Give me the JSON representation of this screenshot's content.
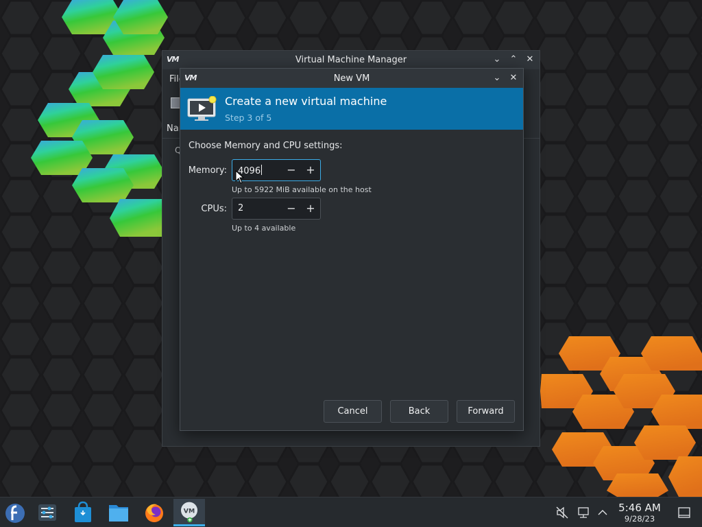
{
  "manager_window": {
    "logo": "VM",
    "title": "Virtual Machine Manager",
    "menu_partial": "File",
    "column_header_partial": "Nam",
    "row_partial": "Q"
  },
  "dialog": {
    "logo": "VM",
    "title": "New VM",
    "banner": {
      "title": "Create a new virtual machine",
      "subtitle": "Step 3 of 5"
    },
    "prompt": "Choose Memory and CPU settings:",
    "memory": {
      "label": "Memory:",
      "value": "4096",
      "hint": "Up to 5922 MiB available on the host"
    },
    "cpus": {
      "label": "CPUs:",
      "value": "2",
      "hint": "Up to 4 available"
    },
    "buttons": {
      "cancel": "Cancel",
      "back": "Back",
      "forward": "Forward"
    }
  },
  "taskbar": {
    "apps": [
      "fedora-launcher",
      "system-settings",
      "software-store",
      "file-manager",
      "firefox",
      "virt-manager"
    ],
    "active_app": "virt-manager",
    "clock": {
      "time": "5:46 AM",
      "date": "9/28/23"
    }
  },
  "colors": {
    "accent": "#3daee9",
    "banner": "#0a6fa7",
    "window_bg": "#2a2e32"
  }
}
